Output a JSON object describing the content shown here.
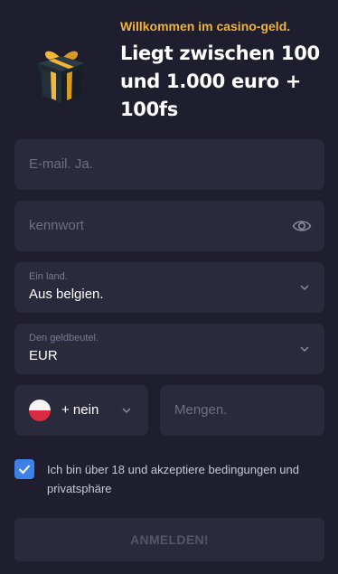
{
  "promo": {
    "welcome": "Willkommen im casino-geld.",
    "headline": "Liegt zwischen 100 und 1.000 euro + 100fs",
    "icon": "gift-icon"
  },
  "form": {
    "email_placeholder": "E-mail. Ja.",
    "password_placeholder": "kennwort",
    "country": {
      "label": "Ein land.",
      "value": "Aus belgien."
    },
    "currency": {
      "label": "Den geldbeutel.",
      "value": "EUR"
    },
    "phone_code": "+ nein",
    "amount_placeholder": "Mengen.",
    "terms": "Ich bin über 18 und akzeptiere bedingungen und privatsphäre",
    "terms_checked": true,
    "submit_label": "ANMELDEN!"
  },
  "colors": {
    "background": "#1e1e2e",
    "field": "#2a2a3d",
    "accent": "#f2b33a",
    "checkbox": "#3c80e8"
  }
}
